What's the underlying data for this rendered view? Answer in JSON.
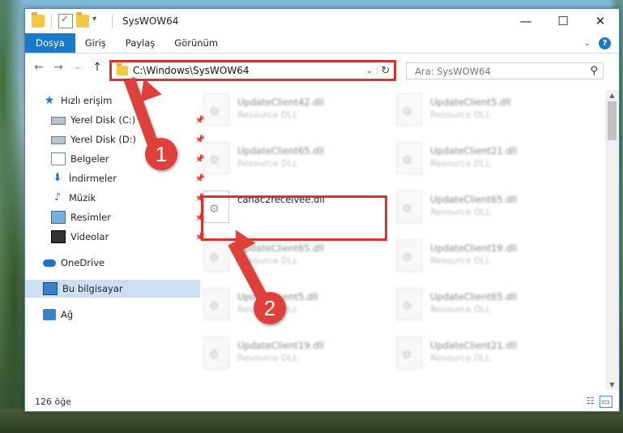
{
  "window": {
    "title": "SysWOW64"
  },
  "ribbon": {
    "tabs": [
      "Dosya",
      "Giriş",
      "Paylaş",
      "Görünüm"
    ]
  },
  "address": {
    "path": "C:\\Windows\\SysWOW64"
  },
  "search": {
    "placeholder": "Ara: SysWOW64"
  },
  "sidebar": {
    "items": [
      {
        "label": "Hızlı erişim"
      },
      {
        "label": "Yerel Disk (C:)"
      },
      {
        "label": "Yerel Disk (D:)"
      },
      {
        "label": "Belgeler"
      },
      {
        "label": "İndirmeler"
      },
      {
        "label": "Müzik"
      },
      {
        "label": "Resimler"
      },
      {
        "label": "Videolar"
      },
      {
        "label": "OneDrive"
      },
      {
        "label": "Bu bilgisayar"
      },
      {
        "label": "Ağ"
      }
    ]
  },
  "files": [
    {
      "name": "UpdateClient42.dll",
      "type": "Resource DLL"
    },
    {
      "name": "UpdateClient5.dll",
      "type": "Resource DLL"
    },
    {
      "name": "UpdateClient65.dll",
      "type": "Resource DLL"
    },
    {
      "name": "UpdateClient21.dll",
      "type": "Resource DLL"
    },
    {
      "name": "canac2receivee.dll",
      "type": ""
    },
    {
      "name": "UpdateClient65.dll",
      "type": "Resource DLL"
    },
    {
      "name": "UpdateClient65.dll",
      "type": "Resource DLL"
    },
    {
      "name": "UpdateClient19.dll",
      "type": "Resource DLL"
    },
    {
      "name": "UpdateClient5.dll",
      "type": "Resource DLL"
    },
    {
      "name": "UpdateClient65.dll",
      "type": "Resource DLL"
    },
    {
      "name": "UpdateClient19.dll",
      "type": "Resource DLL"
    },
    {
      "name": "UpdateClient21.dll",
      "type": "Resource DLL"
    }
  ],
  "status": {
    "count": "126 öğe"
  },
  "annotations": {
    "step1": "1",
    "step2": "2",
    "color": "#e0403a"
  }
}
